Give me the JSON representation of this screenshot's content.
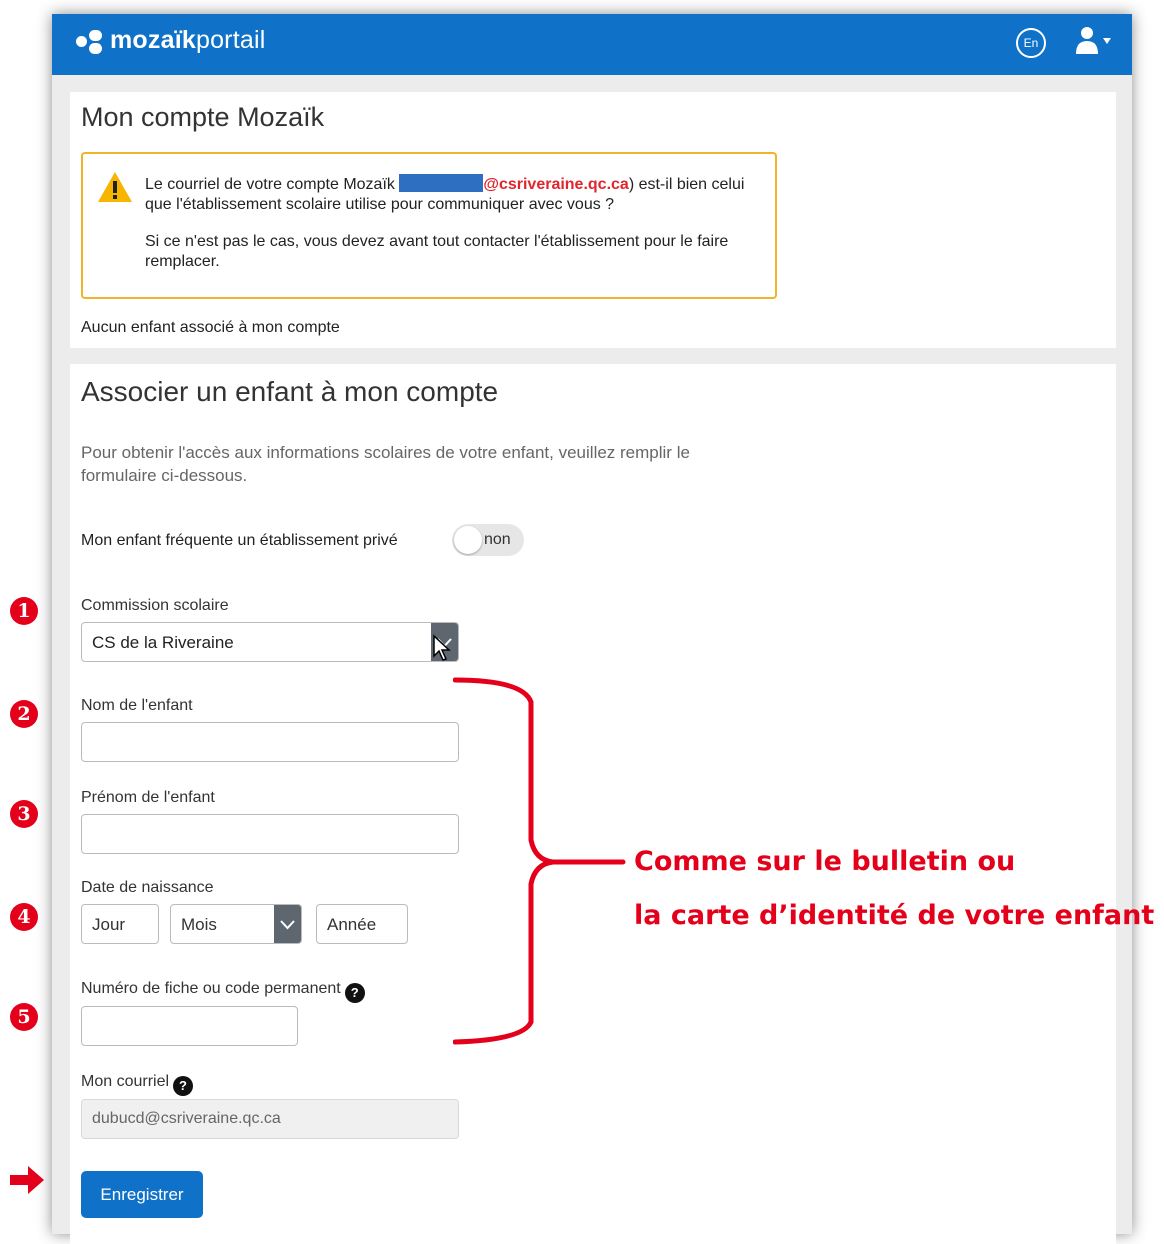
{
  "app": {
    "logo_bold": "mozaïk",
    "logo_light": "portail",
    "lang_button": "En"
  },
  "account_panel": {
    "title": "Mon compte Mozaïk",
    "warning_text_before": "Le courriel de votre compte Mozaïk ",
    "warning_domain": "@csriveraine.qc.ca",
    "warning_text_after": ") est-il bien celui que l'établissement scolaire utilise pour communiquer avec vous ?",
    "warning_text2": "Si ce n'est pas le cas, vous devez avant tout contacter l'établissement pour le faire remplacer.",
    "no_child": "Aucun enfant associé à mon compte"
  },
  "form": {
    "title": "Associer un enfant à mon compte",
    "intro": "Pour obtenir l'accès aux informations scolaires de votre enfant, veuillez remplir le formulaire ci-dessous.",
    "private_label": "Mon enfant fréquente un établissement privé",
    "private_toggle": "non",
    "commission_label": "Commission scolaire",
    "commission_value": "CS de la Riveraine",
    "last_name_label": "Nom de l'enfant",
    "last_name_value": "",
    "first_name_label": "Prénom de l'enfant",
    "first_name_value": "",
    "birth_label": "Date de naissance",
    "day_placeholder": "Jour",
    "month_value": "Mois",
    "year_placeholder": "Année",
    "file_label": "Numéro de fiche ou code permanent",
    "file_value": "",
    "email_label": "Mon courriel",
    "email_value": "dubucd@csriveraine.qc.ca",
    "help_glyph": "?",
    "save_label": "Enregistrer"
  },
  "annotations": {
    "markers": [
      "1",
      "2",
      "3",
      "4",
      "5"
    ],
    "note_line1": "Comme sur le bulletin ou",
    "note_line2": "la carte d’identité de votre enfant",
    "note_color": "#e4001b"
  }
}
